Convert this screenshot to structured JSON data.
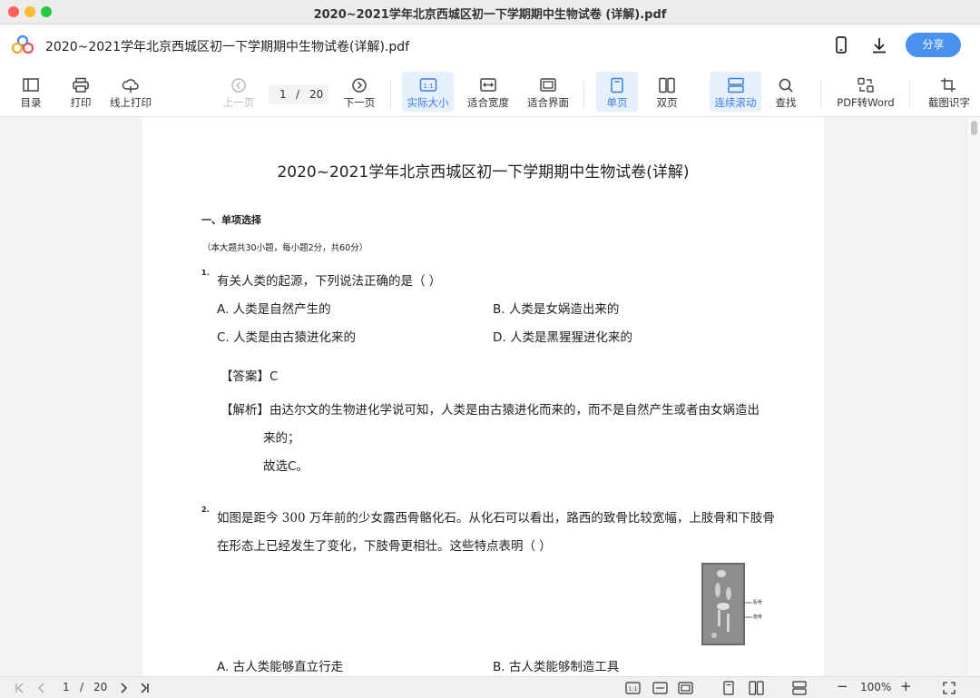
{
  "window": {
    "title": "2020~2021学年北京西城区初一下学期期中生物试卷 (详解).pdf"
  },
  "header": {
    "doc_title": "2020~2021学年北京西城区初一下学期期中生物试卷(详解).pdf",
    "share_label": "分享"
  },
  "toolbar": {
    "toc": "目录",
    "print": "打印",
    "online_print": "线上打印",
    "prev": "上一页",
    "current_page": "1",
    "page_sep": "/",
    "total_pages": "20",
    "next": "下一页",
    "actual_size": "实际大小",
    "fit_width": "适合宽度",
    "fit_page": "适合界面",
    "single_page": "单页",
    "double_page": "双页",
    "continuous": "连续滚动",
    "find": "查找",
    "pdf_to_word": "PDF转Word",
    "ocr": "截图识字",
    "actual_size_badge": "1:1"
  },
  "document": {
    "title": "2020~2021学年北京西城区初一下学期期中生物试卷(详解)",
    "section_heading": "一、单项选择",
    "section_note": "（本大题共30小题，每小题2分，共60分）",
    "q1": {
      "num": "1.",
      "stem": "有关人类的起源，下列说法正确的是（    ）",
      "optA": "A. 人类是自然产生的",
      "optB": "B. 人类是女娲造出来的",
      "optC": "C. 人类是由古猿进化来的",
      "optD": "D. 人类是黑猩猩进化来的",
      "answer_label": "【答案】",
      "answer": "C",
      "analysis_label": "【解析】",
      "analysis_line1": "由达尔文的生物进化学说可知，人类是由古猿进化而来的，而不是自然产生或者由女娲造出",
      "analysis_line2": "来的；",
      "analysis_line3": "故选C。"
    },
    "q2": {
      "num": "2.",
      "stem_line1": "如图是距今 300 万年前的少女露西骨骼化石。从化石可以看出，路西的致骨比较宽幅，上肢骨和下肢骨",
      "stem_line2": "在形态上已经发生了变化，下肢骨更相壮。这些特点表明（    ）",
      "fig_label1": "股骨",
      "fig_label2": "髋骨",
      "optA": "A. 古人类能够直立行走",
      "optB": "B. 古人类能够制造工具"
    }
  },
  "bottombar": {
    "current_page": "1",
    "sep": "/",
    "total_pages": "20",
    "zoom": "100%",
    "zoom_minus": "−",
    "zoom_plus": "+"
  },
  "colors": {
    "accent": "#4a90f0",
    "active_tool_bg": "#e6f0fd",
    "active_tool_text": "#3a7ee4",
    "traffic_red": "#fe5f57",
    "traffic_yellow": "#febc2e",
    "traffic_green": "#28c840"
  }
}
